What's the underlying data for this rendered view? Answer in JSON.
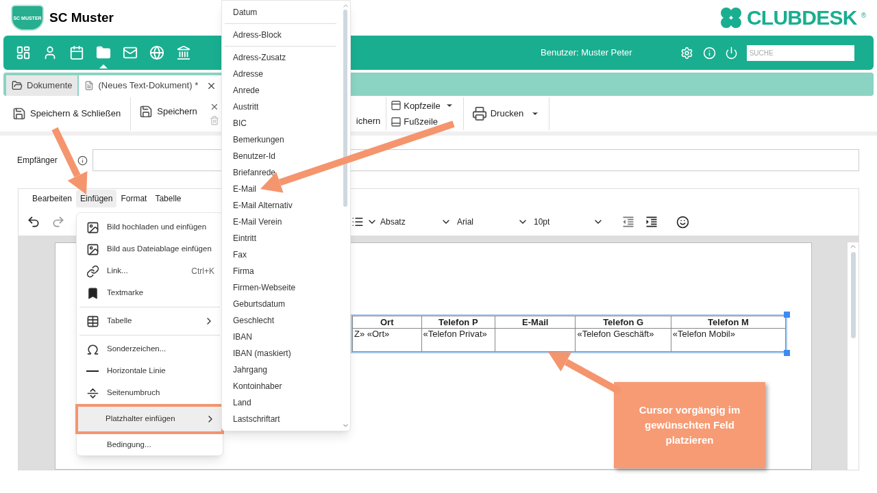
{
  "brand": {
    "club_name": "SC Muster",
    "logo_text": "SC MUSTER",
    "product": "CLUBDESK",
    "registered": "®"
  },
  "nav": {
    "items": [
      {
        "kind": "dashboard",
        "selected": false
      },
      {
        "kind": "person",
        "selected": false
      },
      {
        "kind": "calendar",
        "selected": false
      },
      {
        "kind": "folder",
        "selected": true
      },
      {
        "kind": "mail",
        "selected": false
      },
      {
        "kind": "globe",
        "selected": false
      },
      {
        "kind": "bank",
        "selected": false
      }
    ],
    "user": "Benutzer: Muster Peter",
    "search": {
      "placeholder": "SUCHE"
    }
  },
  "tabs": [
    {
      "label": "Dokumente",
      "kind": "folder",
      "selected": false,
      "closable": false
    },
    {
      "label": "(Neues Text-Dokument) *",
      "kind": "document",
      "selected": true,
      "closable": true
    }
  ],
  "toolbar": {
    "save_close": "Speichern & Schließen",
    "save": "Speichern",
    "save_as": "ichern",
    "header": "Kopfzeile",
    "footer": "Fußzeile",
    "print": "Drucken"
  },
  "recipient": {
    "label": "Empfänger"
  },
  "editor": {
    "menu": [
      {
        "label": "Bearbeiten",
        "selected": false
      },
      {
        "label": "Einfügen",
        "selected": true
      },
      {
        "label": "Format",
        "selected": false
      },
      {
        "label": "Tabelle",
        "selected": false
      }
    ],
    "block_format": "Absatz",
    "font": "Arial",
    "font_size": "10pt",
    "table": {
      "columns": [
        "Ort",
        "Telefon P",
        "E-Mail",
        "Telefon G",
        "Telefon M"
      ],
      "rows": [
        [
          "Z» «Ort»",
          "«Telefon Privat»",
          "",
          "«Telefon Geschäft»",
          "«Telefon Mobil»"
        ]
      ]
    }
  },
  "insert_menu": {
    "groups": [
      [
        {
          "label": "Bild hochladen und einfügen",
          "kind": "image",
          "selected": false
        },
        {
          "label": "Bild aus Dateiablage einfügen",
          "kind": "image",
          "selected": false
        },
        {
          "label": "Link...",
          "kind": "link",
          "shortcut": "Ctrl+K",
          "selected": false
        },
        {
          "label": "Textmarke",
          "kind": "bookmark",
          "selected": false
        }
      ],
      [
        {
          "label": "Tabelle",
          "kind": "table",
          "submenu": true,
          "selected": false
        }
      ],
      [
        {
          "label": "Sonderzeichen...",
          "kind": "omega",
          "selected": false
        },
        {
          "label": "Horizontale Linie",
          "kind": "rule",
          "selected": false
        },
        {
          "label": "Seitenumbruch",
          "kind": "pagebreak",
          "selected": false
        },
        {
          "label": "Platzhalter einfügen",
          "kind": "none",
          "submenu": true,
          "selected": true
        },
        {
          "label": "Bedingung...",
          "kind": "none",
          "selected": false
        }
      ]
    ]
  },
  "placeholder_menu": {
    "groups": [
      [
        "Datum"
      ],
      [
        "Adress-Block"
      ],
      [
        "Adress-Zusatz",
        "Adresse",
        "Anrede",
        "Austritt",
        "BIC",
        "Bemerkungen",
        "Benutzer-Id",
        "Briefanrede",
        "E-Mail",
        "E-Mail Alternativ",
        "E-Mail Verein",
        "Eintritt",
        "Fax",
        "Firma",
        "Firmen-Webseite",
        "Geburtsdatum",
        "Geschlecht",
        "IBAN",
        "IBAN (maskiert)",
        "Jahrgang",
        "Kontoinhaber",
        "Land",
        "Lastschriftart"
      ]
    ]
  },
  "callout": "Cursor vorgängig im gewünschten Feld platzieren"
}
